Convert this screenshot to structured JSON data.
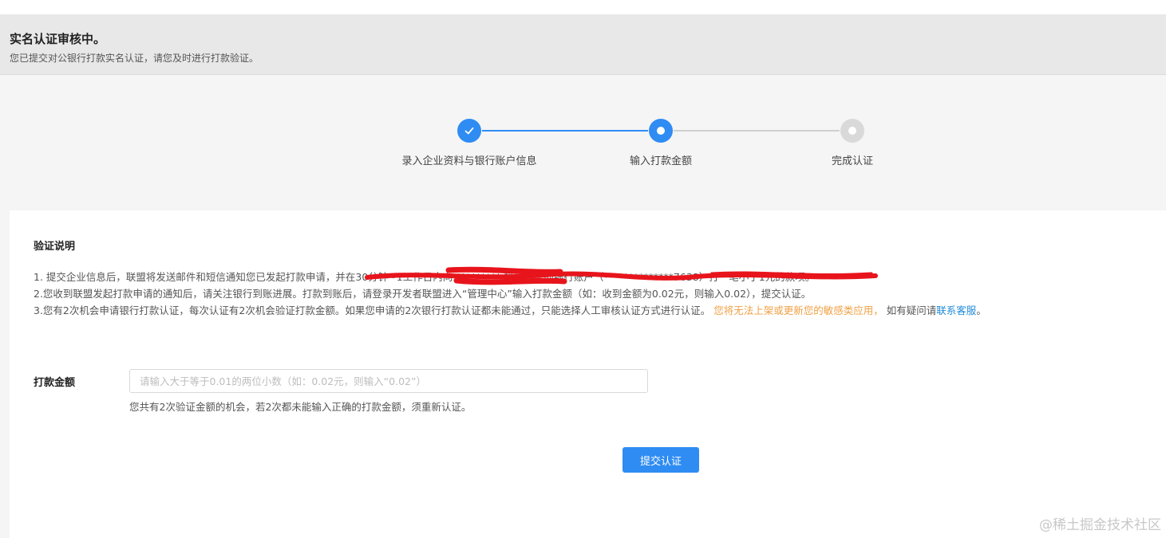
{
  "banner": {
    "title": "实名认证审核中。",
    "subtitle": "您已提交对公银行打款实名认证，请您及时进行打款验证。"
  },
  "steps": [
    {
      "label": "录入企业资料与银行账户信息",
      "status": "done",
      "icon": "check-icon"
    },
    {
      "label": "输入打款金额",
      "status": "current",
      "icon": "dot-icon"
    },
    {
      "label": "完成认证",
      "status": "pending",
      "icon": "dot-icon"
    }
  ],
  "colors": {
    "primary": "#2f8cf3",
    "warn": "#f0a045",
    "link": "#1f8ad9",
    "redaction": "#e8141c"
  },
  "verify": {
    "title": "验证说明",
    "rule1": "1. 提交企业信息后，联盟将发送邮件和短信通知您已发起打款申请，并在30分钟~1工作日内向 ********* 帐号提交的银行账户（**************7638）打一笔小于1元的款项。",
    "rule2": "2.您收到联盟发起打款申请的通知后，请关注银行到账进展。打款到账后，请登录开发者联盟进入“管理中心”输入打款金额（如：收到金额为0.02元，则输入0.02），提交认证。",
    "rule3_main": "3.您有2次机会申请银行打款认证，每次认证有2次机会验证打款金额。如果您申请的2次银行打款认证都未能通过，只能选择人工审核认证方式进行认证。",
    "rule3_warn": "您将无法上架或更新您的敏感类应用，",
    "rule3_tail": "如有疑问请",
    "rule3_link": "联系客服",
    "rule3_end": "。"
  },
  "form": {
    "label": "打款金额",
    "value": "",
    "placeholder": "请输入大于等于0.01的两位小数（如：0.02元，则输入“0.02”）",
    "hint": "您共有2次验证金额的机会，若2次都未能输入正确的打款金额，须重新认证。",
    "submit_label": "提交认证"
  },
  "watermark": "@稀土掘金技术社区"
}
